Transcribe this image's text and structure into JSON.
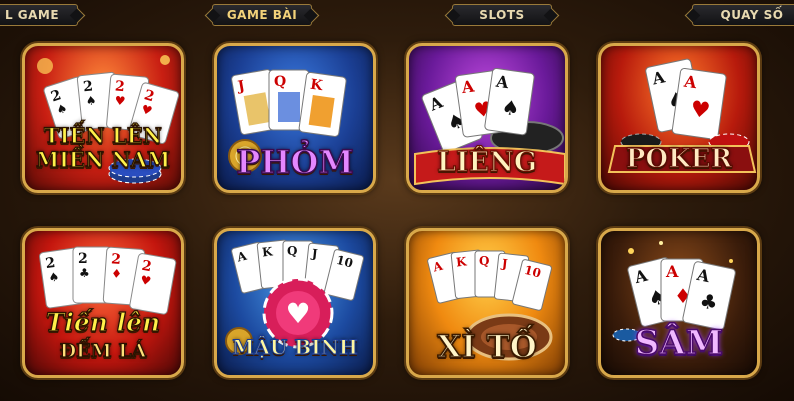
{
  "tabs": [
    {
      "label": "L GAME",
      "active": false
    },
    {
      "label": "GAME BÀI",
      "active": true
    },
    {
      "label": "SLOTS",
      "active": false
    },
    {
      "label": "QUAY SỐ",
      "active": false
    }
  ],
  "games": [
    {
      "line1": "TIẾN LÊN",
      "line2": "MIỀN NAM",
      "card_ranks": [
        "2",
        "2",
        "2",
        "2"
      ],
      "icon": "playing-cards-icon"
    },
    {
      "line1": "PHỎM",
      "line2": "",
      "card_ranks": [
        "J",
        "Q",
        "K"
      ],
      "icon": "playing-cards-icon"
    },
    {
      "line1": "LIÊNG",
      "line2": "",
      "card_ranks": [
        "A",
        "A",
        "A"
      ],
      "icon": "playing-cards-icon"
    },
    {
      "line1": "POKER",
      "line2": "",
      "card_ranks": [
        "A",
        "A"
      ],
      "icon": "playing-cards-icon"
    },
    {
      "line1": "Tiến lên",
      "line2": "ĐẾM LÁ",
      "card_ranks": [
        "2",
        "2",
        "2",
        "2"
      ],
      "icon": "playing-cards-icon"
    },
    {
      "line1": "MẬU BINH",
      "line2": "",
      "card_ranks": [
        "A",
        "K",
        "Q",
        "J",
        "10"
      ],
      "icon": "poker-chip-icon"
    },
    {
      "line1": "XÌ TỐ",
      "line2": "",
      "card_ranks": [
        "A",
        "K",
        "Q",
        "J",
        "10"
      ],
      "icon": "poker-chip-icon"
    },
    {
      "line1": "SÂM",
      "line2": "",
      "card_ranks": [
        "A",
        "A",
        "A"
      ],
      "icon": "playing-cards-icon"
    }
  ],
  "colors": {
    "frame": "#d8a84a",
    "tab_active": "#f2d27a"
  }
}
